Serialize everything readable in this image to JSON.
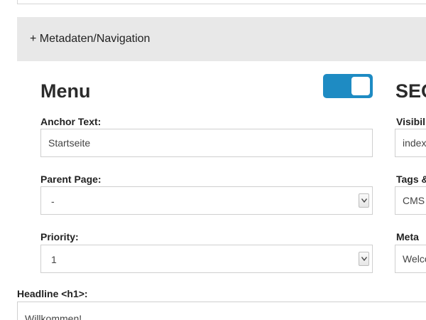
{
  "metadata_toggle": {
    "label": "+ Metadaten/Navigation"
  },
  "menu": {
    "title": "Menu",
    "enabled": true,
    "anchor_text": {
      "label": "Anchor Text:",
      "value": "Startseite"
    },
    "parent_page": {
      "label": "Parent Page:",
      "value": "-"
    },
    "priority": {
      "label": "Priority:",
      "value": "1"
    }
  },
  "seo": {
    "title": "SEO",
    "visibility": {
      "label": "Visibility:",
      "value": "index"
    },
    "tags": {
      "label": "Tags & Keywords:",
      "value": "CMS"
    },
    "meta": {
      "label": "Meta Description:",
      "value": "Welcome"
    }
  },
  "headline": {
    "label": "Headline <h1>:",
    "value": "Willkommen!"
  },
  "colors": {
    "accent": "#1e8bc3",
    "bar": "#e8e8e8"
  }
}
